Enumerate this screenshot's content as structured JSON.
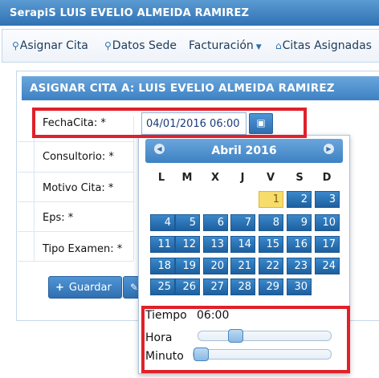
{
  "window": {
    "title": "SerapiS LUIS EVELIO ALMEIDA RAMIREZ"
  },
  "menu": {
    "items": [
      {
        "label": "Asignar Cita",
        "icon": "search-icon"
      },
      {
        "label": "Datos Sede",
        "icon": "search-icon"
      },
      {
        "label": "Facturación",
        "icon": "chevron-down-icon"
      },
      {
        "label": "Citas Asignadas",
        "icon": "home-icon"
      }
    ]
  },
  "panel": {
    "title": "ASIGNAR CITA A: LUIS EVELIO ALMEIDA RAMIREZ"
  },
  "form": {
    "fecha_label": "FechaCita: *",
    "fecha_value": "04/01/2016 06:00",
    "consultorio_label": "Consultorio: *",
    "motivo_label": "Motivo Cita: *",
    "eps_label": "Eps: *",
    "tipo_label": "Tipo Examen: *"
  },
  "buttons": {
    "guardar": "Guardar",
    "guardar_icon": "+"
  },
  "datepicker": {
    "month_title": "Abril 2016",
    "prev": "◀",
    "next": "▶",
    "weekdays": [
      "L",
      "M",
      "X",
      "J",
      "V",
      "S",
      "D"
    ],
    "weeks": [
      [
        "",
        "",
        "",
        "",
        "1",
        "2",
        "3"
      ],
      [
        "4",
        "5",
        "6",
        "7",
        "8",
        "9",
        "10"
      ],
      [
        "11",
        "12",
        "13",
        "14",
        "15",
        "16",
        "17"
      ],
      [
        "18",
        "19",
        "20",
        "21",
        "22",
        "23",
        "24"
      ],
      [
        "25",
        "26",
        "27",
        "28",
        "29",
        "30",
        ""
      ]
    ],
    "highlighted_day": "1",
    "time_label": "Tiempo",
    "time_value": "06:00",
    "hour_label": "Hora",
    "minute_label": "Minuto",
    "hour_level": 0.25,
    "minute_level": 0.0
  },
  "colors": {
    "accent": "#3d81c3",
    "highlight_box": "#e0202a",
    "today": "#f8dc6b"
  }
}
